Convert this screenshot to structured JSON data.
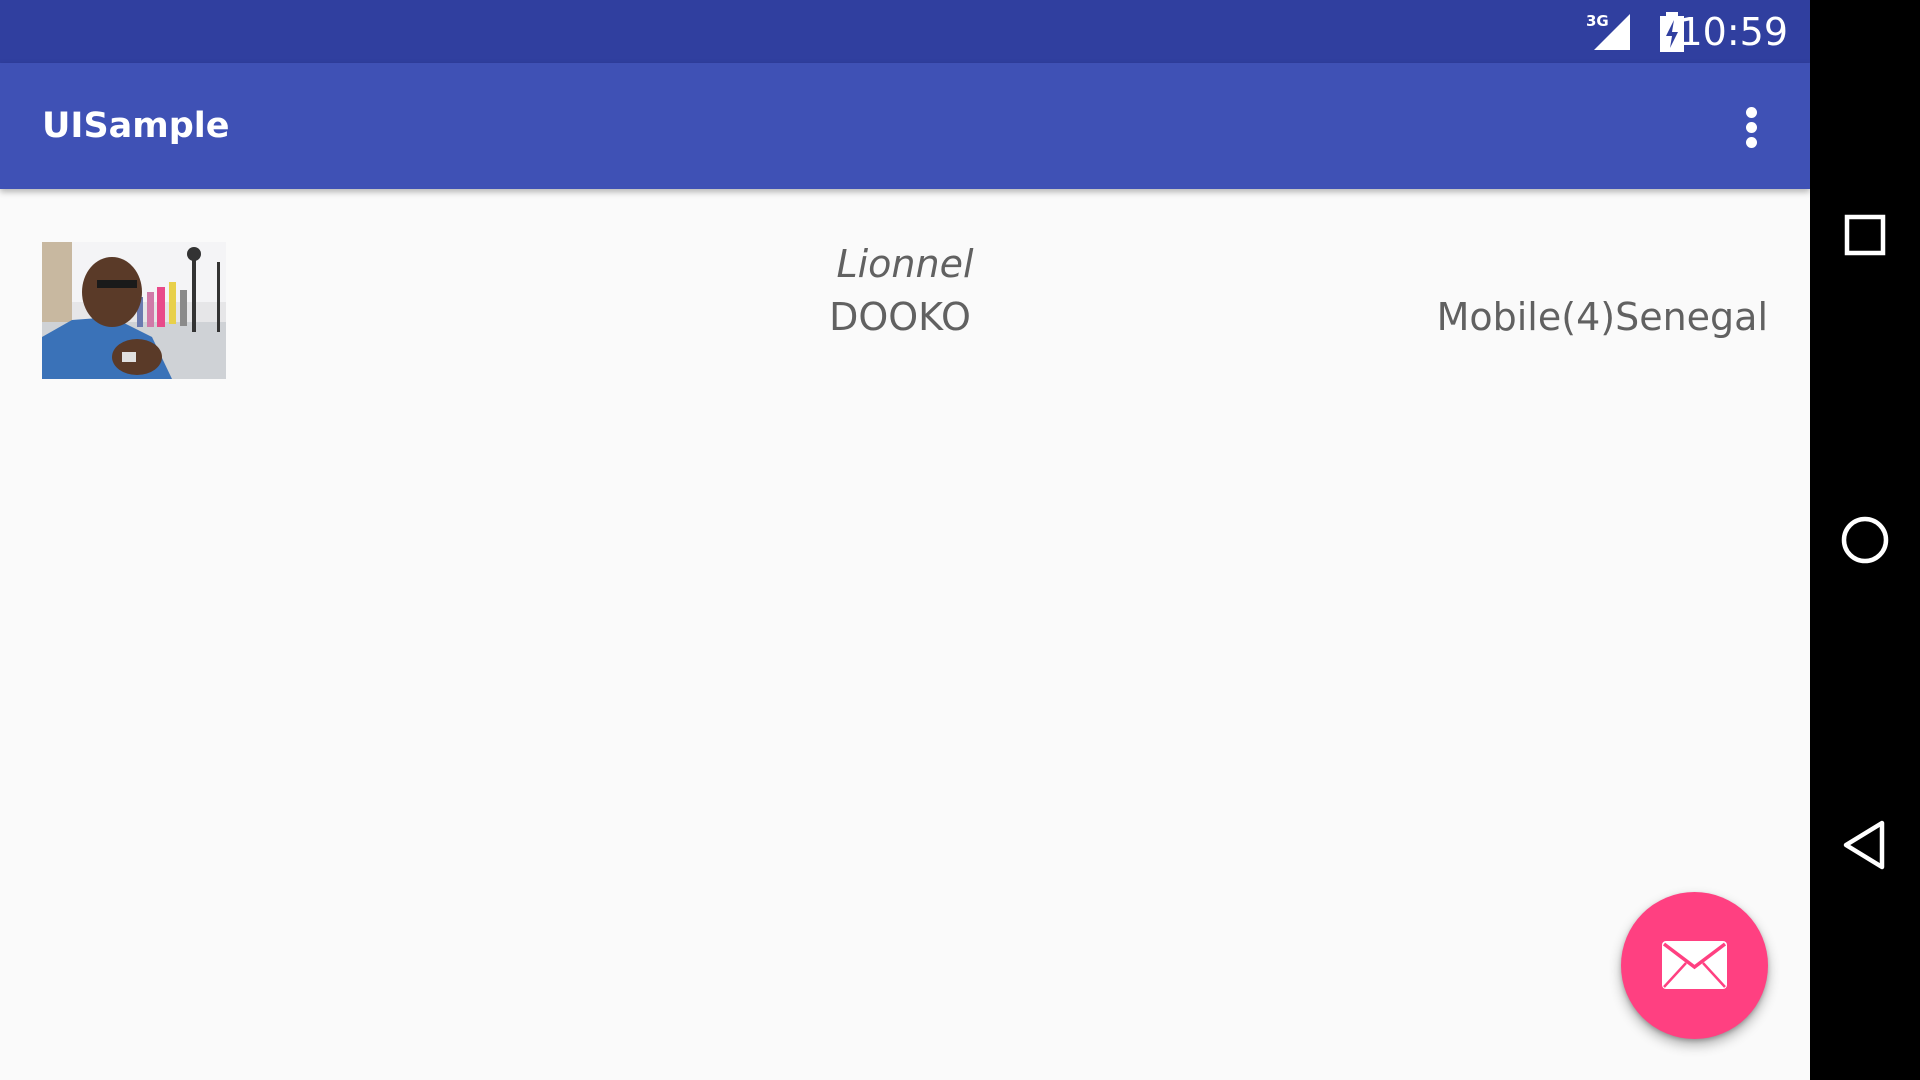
{
  "status_bar": {
    "network_type": "3G",
    "time": "10:59",
    "icons": [
      "signal-icon",
      "battery-charging-icon"
    ]
  },
  "app_bar": {
    "title": "UISample",
    "overflow_icon": "more-vert-icon"
  },
  "list": {
    "items": [
      {
        "avatar": "profile-photo",
        "first_name": "Lionnel",
        "last_name": "DOOKO",
        "subtitle": "Mobile(4)Senegal"
      }
    ]
  },
  "fab": {
    "icon": "email-icon",
    "color": "#ff4081"
  },
  "nav_bar": {
    "buttons": [
      "recents-icon",
      "home-icon",
      "back-icon"
    ]
  },
  "colors": {
    "status_bar": "#303f9f",
    "app_bar": "#3f51b5",
    "accent": "#ff4081",
    "background": "#fafafa",
    "text": "#616161"
  }
}
